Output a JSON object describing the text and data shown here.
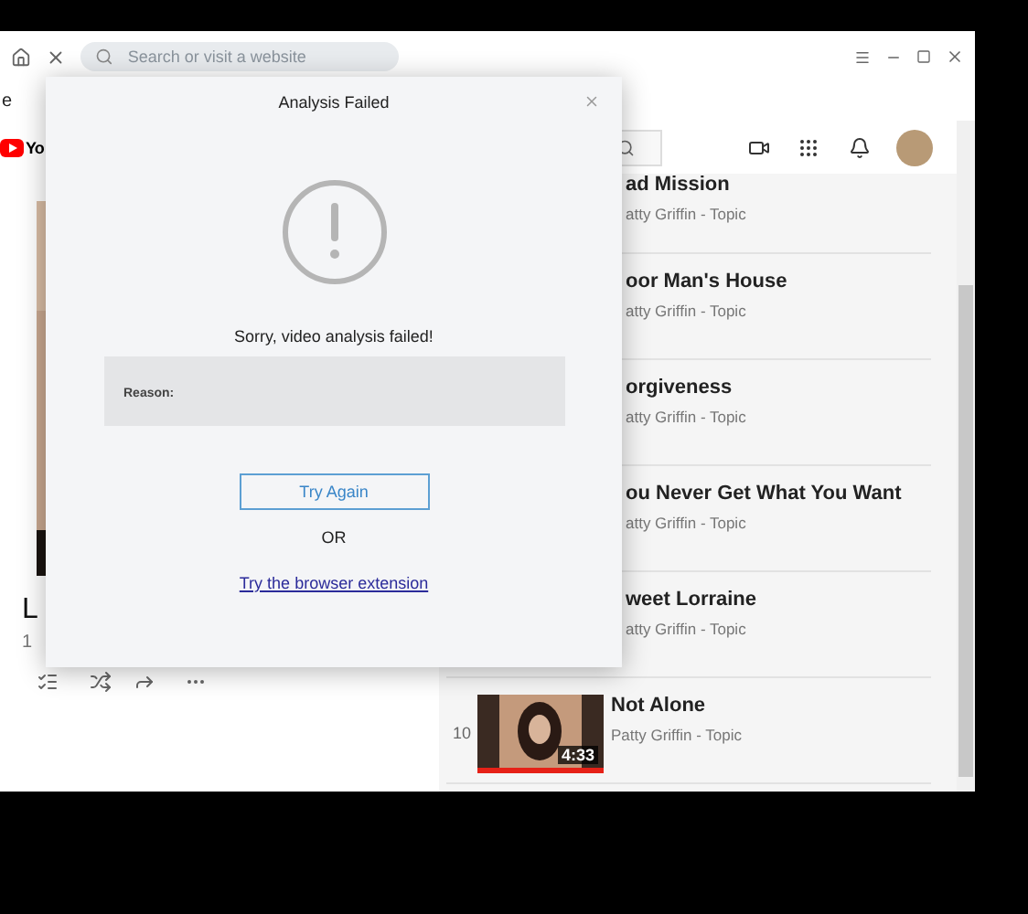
{
  "browser": {
    "search_placeholder": "Search or visit a website"
  },
  "page_edge_text": "e",
  "youtube": {
    "logo_text": "Yo"
  },
  "video": {
    "title": "L",
    "meta": "1"
  },
  "playlist": [
    {
      "kind": "covered",
      "title": "ad Mission",
      "channel": "atty Griffin - Topic"
    },
    {
      "kind": "covered",
      "title": "oor Man's House",
      "channel": "atty Griffin - Topic"
    },
    {
      "kind": "covered",
      "title": "orgiveness",
      "channel": "atty Griffin - Topic"
    },
    {
      "kind": "covered",
      "title": "ou Never Get What You Want",
      "channel": "atty Griffin - Topic"
    },
    {
      "kind": "covered",
      "title": "weet Lorraine",
      "channel": "atty Griffin - Topic"
    },
    {
      "kind": "thumb",
      "number": "10",
      "duration": "4:33",
      "title": "Not Alone",
      "channel": "Patty Griffin - Topic"
    }
  ],
  "dialog": {
    "title": "Analysis Failed",
    "message": "Sorry, video analysis failed!",
    "reason_label": "Reason:",
    "retry_button": "Try Again",
    "separator": "OR",
    "link": "Try the browser extension"
  }
}
